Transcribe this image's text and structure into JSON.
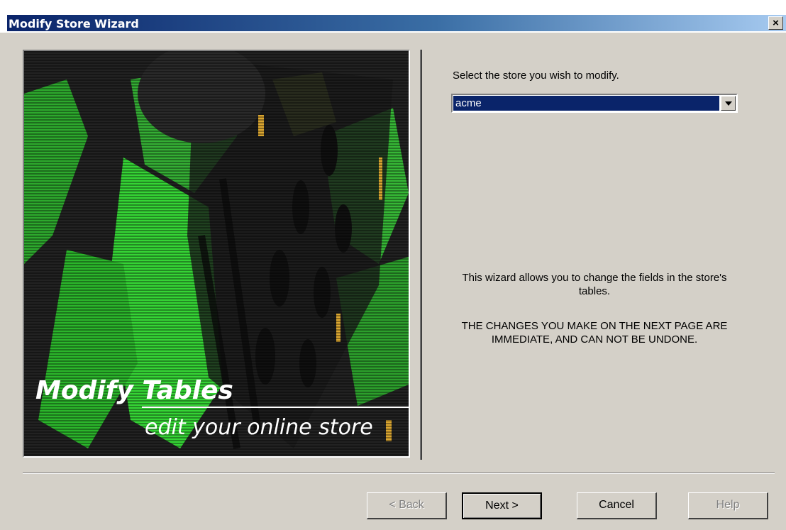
{
  "window": {
    "title": "Modify Store Wizard",
    "close_glyph": "✕"
  },
  "art": {
    "title_line": "Modify Tables",
    "subtitle_line": "edit your online store",
    "colors": {
      "green": "#3ad13a",
      "dark": "#1a1a1a"
    }
  },
  "store_select": {
    "prompt": "Select the store you wish to modify.",
    "selected": "acme"
  },
  "info_text": "This wizard allows you to change the fields in the store's tables.",
  "warning_text": "THE CHANGES YOU MAKE ON THE NEXT PAGE ARE IMMEDIATE, AND CAN NOT BE UNDONE.",
  "buttons": {
    "back": "< Back",
    "next": "Next >",
    "cancel": "Cancel",
    "help": "Help"
  }
}
